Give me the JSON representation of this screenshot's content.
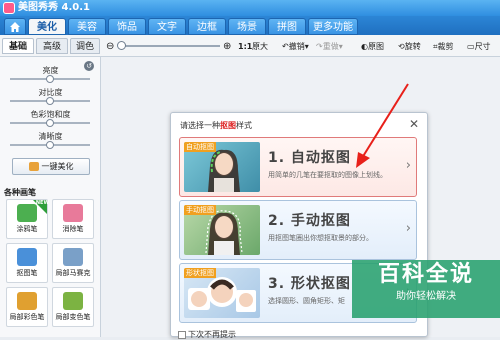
{
  "window": {
    "title": "美图秀秀 4.0.1"
  },
  "tabs": [
    {
      "label": "美化",
      "active": true
    },
    {
      "label": "美容"
    },
    {
      "label": "饰品"
    },
    {
      "label": "文字"
    },
    {
      "label": "边框"
    },
    {
      "label": "场景"
    },
    {
      "label": "拼图"
    },
    {
      "label": "更多功能"
    }
  ],
  "subtabs": [
    "基础",
    "高级",
    "调色"
  ],
  "toolbar": {
    "zoom_label": "1:1",
    "zoom_text": "原大",
    "rotate": "撤销",
    "redo": "重做",
    "original": "原图",
    "rotate2": "旋转",
    "crop": "裁剪",
    "size": "尺寸"
  },
  "adjustments": [
    {
      "label": "亮度",
      "level": 0.5
    },
    {
      "label": "对比度",
      "level": 0.5
    },
    {
      "label": "色彩饱和度",
      "level": 0.5
    },
    {
      "label": "清晰度",
      "level": 0.5
    }
  ],
  "one_key_button": "一键美化",
  "tools_section": "各种画笔",
  "tools": [
    {
      "label": "涂鸦笔",
      "color": "#4caf50"
    },
    {
      "label": "消除笔",
      "color": "#e87a9a"
    },
    {
      "label": "抠图笔",
      "color": "#4a90d9"
    },
    {
      "label": "局部马赛克",
      "color": "#7aa0c8"
    },
    {
      "label": "局部彩色笔",
      "color": "#e0a030"
    },
    {
      "label": "局部变色笔",
      "color": "#7cb342"
    }
  ],
  "new_badge": "NEW",
  "dialog": {
    "title_pre": "请选择一种",
    "title_hl": "抠图",
    "title_post": "样式",
    "close": "✕",
    "options": [
      {
        "tag": "自动抠图",
        "title": "1. 自动抠图",
        "desc": "用简单的几笔在要抠取的图像上划线。"
      },
      {
        "tag": "手动抠图",
        "title": "2. 手动抠图",
        "desc": "用抠图笔圈出你想抠取景的部分。"
      },
      {
        "tag": "形状抠图",
        "title": "3. 形状抠图",
        "desc": "选择圆形、圆角矩形、矩"
      }
    ],
    "checkbox": "下次不再提示"
  },
  "watermark": {
    "line1": "百科全说",
    "line2": "助你轻松解决"
  }
}
